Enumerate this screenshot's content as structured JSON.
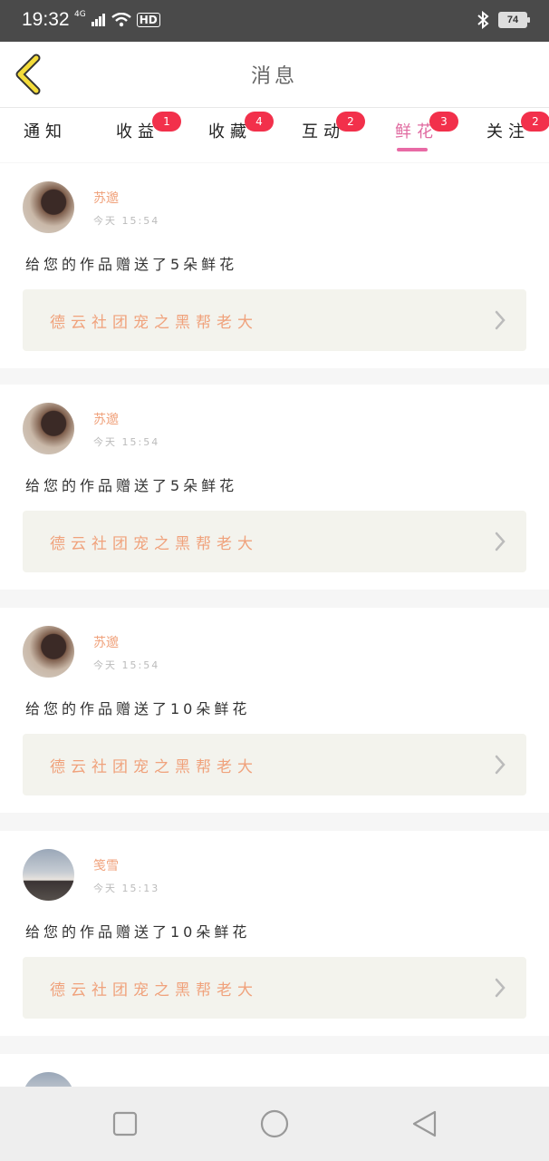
{
  "status_bar": {
    "time": "19:32",
    "network": "4G",
    "hd": "HD",
    "battery": "74"
  },
  "header": {
    "title": "消息",
    "back_icon": "back-chevron-icon"
  },
  "tabs": [
    {
      "label": "通知",
      "badge": ""
    },
    {
      "label": "收益",
      "badge": "1"
    },
    {
      "label": "收藏",
      "badge": "4"
    },
    {
      "label": "互动",
      "badge": "2"
    },
    {
      "label": "鲜花",
      "badge": "3",
      "active": true
    },
    {
      "label": "关注",
      "badge": "2"
    }
  ],
  "cards": [
    {
      "user": "苏邈",
      "time": "今天 15:54",
      "message": "给您的作品赠送了5朵鲜花",
      "work": "德云社团宠之黑帮老大"
    },
    {
      "user": "苏邈",
      "time": "今天 15:54",
      "message": "给您的作品赠送了5朵鲜花",
      "work": "德云社团宠之黑帮老大"
    },
    {
      "user": "苏邈",
      "time": "今天 15:54",
      "message": "给您的作品赠送了10朵鲜花",
      "work": "德云社团宠之黑帮老大"
    },
    {
      "user": "笺雪",
      "time": "今天 15:13",
      "message": "给您的作品赠送了10朵鲜花",
      "work": "德云社团宠之黑帮老大"
    }
  ],
  "colors": {
    "accent_pink": "#e86aa5",
    "badge_red": "#f2304b",
    "name_orange": "#f0a27c",
    "back_yellow": "#f4dc3a"
  }
}
